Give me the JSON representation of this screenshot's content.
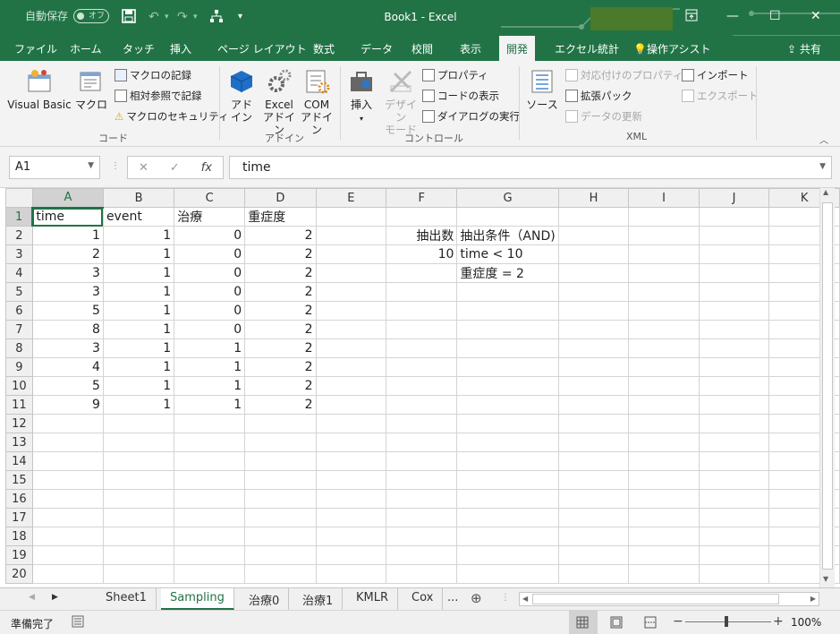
{
  "qat": {
    "autosave_label": "自動保存",
    "autosave_state": "オフ"
  },
  "window": {
    "title": "Book1 - Excel"
  },
  "tabs": [
    "ファイル",
    "ホーム",
    "タッチ",
    "挿入",
    "ページ レイアウト",
    "数式",
    "データ",
    "校閲",
    "表示",
    "開発",
    "エクセル統計",
    "操作アシスト",
    "共有"
  ],
  "ribbon": {
    "code": {
      "visual_basic": "Visual Basic",
      "macro": "マクロ",
      "record_macro": "マクロの記録",
      "relative_ref": "相対参照で記録",
      "macro_security": "マクロのセキュリティ",
      "group": "コード"
    },
    "addins": {
      "addin_l1": "アド",
      "addin_l2": "イン",
      "excel_l1": "Excel",
      "excel_l2": "アドイン",
      "com_l1": "COM",
      "com_l2": "アドイン",
      "group": "アドイン"
    },
    "controls": {
      "insert": "挿入",
      "design_l1": "デザイン",
      "design_l2": "モード",
      "properties": "プロパティ",
      "view_code": "コードの表示",
      "run_dialog": "ダイアログの実行",
      "group": "コントロール"
    },
    "xml": {
      "source": "ソース",
      "map_props": "対応付けのプロパティ",
      "expansion": "拡張パック",
      "refresh": "データの更新",
      "import": "インポート",
      "export": "エクスポート",
      "group": "XML"
    }
  },
  "formula_bar": {
    "name_box": "A1",
    "fx": "fx",
    "value": "time"
  },
  "columns": [
    "A",
    "B",
    "C",
    "D",
    "E",
    "F",
    "G",
    "H",
    "I",
    "J",
    "K"
  ],
  "rows": [
    "1",
    "2",
    "3",
    "4",
    "5",
    "6",
    "7",
    "8",
    "9",
    "10",
    "11",
    "12",
    "13",
    "14",
    "15",
    "16",
    "17",
    "18",
    "19",
    "20"
  ],
  "cells": {
    "header": [
      "time",
      "event",
      "治療",
      "重症度"
    ],
    "data": [
      [
        "1",
        "1",
        "0",
        "2"
      ],
      [
        "2",
        "1",
        "0",
        "2"
      ],
      [
        "3",
        "1",
        "0",
        "2"
      ],
      [
        "3",
        "1",
        "0",
        "2"
      ],
      [
        "5",
        "1",
        "0",
        "2"
      ],
      [
        "8",
        "1",
        "0",
        "2"
      ],
      [
        "3",
        "1",
        "1",
        "2"
      ],
      [
        "4",
        "1",
        "1",
        "2"
      ],
      [
        "5",
        "1",
        "1",
        "2"
      ],
      [
        "9",
        "1",
        "1",
        "2"
      ]
    ],
    "f2": "抽出数",
    "g2": "抽出条件（AND)",
    "f3": "10",
    "g3": "time < 10",
    "g4": "重症度 = 2"
  },
  "sheet_tabs": [
    "Sheet1",
    "Sampling",
    "治療0",
    "治療1",
    "KMLR",
    "Cox",
    "..."
  ],
  "status": {
    "ready": "準備完了",
    "zoom": "100%"
  }
}
